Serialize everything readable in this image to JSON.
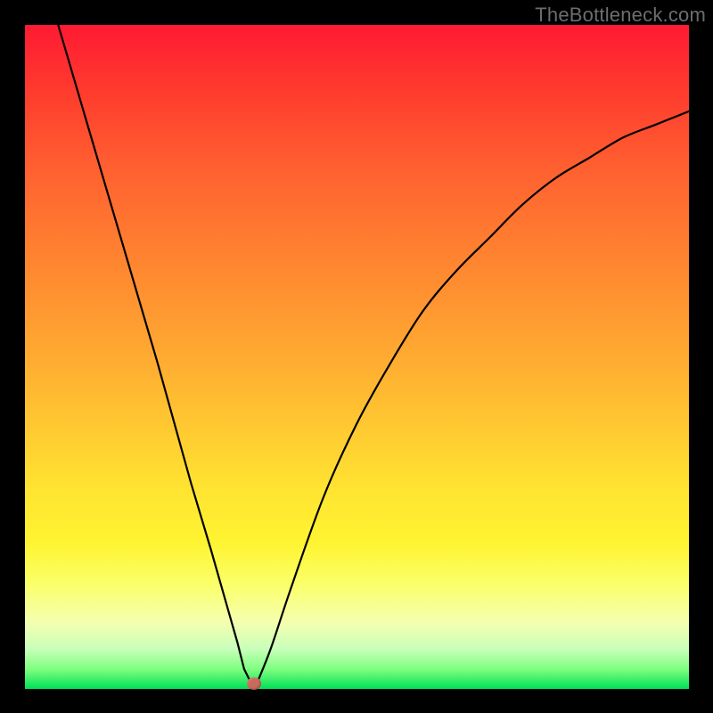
{
  "watermark": "TheBottleneck.com",
  "colors": {
    "curve": "#000000",
    "dot": "#c96a5a",
    "frame": "#000000"
  },
  "chart_data": {
    "type": "line",
    "title": "",
    "xlabel": "",
    "ylabel": "",
    "xlim": [
      0,
      100
    ],
    "ylim": [
      0,
      100
    ],
    "grid": false,
    "note": "V-shaped bottleneck curve; minimum at x≈34; y scales 0=bottom(green) to 100=top(red). Values estimated from pixels.",
    "series": [
      {
        "name": "bottleneck-curve",
        "x": [
          5,
          10,
          15,
          20,
          25,
          28,
          30,
          32,
          33,
          34,
          35,
          37,
          40,
          45,
          50,
          55,
          60,
          65,
          70,
          75,
          80,
          85,
          90,
          95,
          100
        ],
        "values": [
          100,
          83,
          66,
          49,
          31,
          21,
          14,
          7,
          3,
          1,
          1,
          6,
          15,
          29,
          40,
          49,
          57,
          63,
          68,
          73,
          77,
          80,
          83,
          85,
          87
        ]
      }
    ],
    "marker": {
      "x": 34.5,
      "y": 0.8
    }
  }
}
